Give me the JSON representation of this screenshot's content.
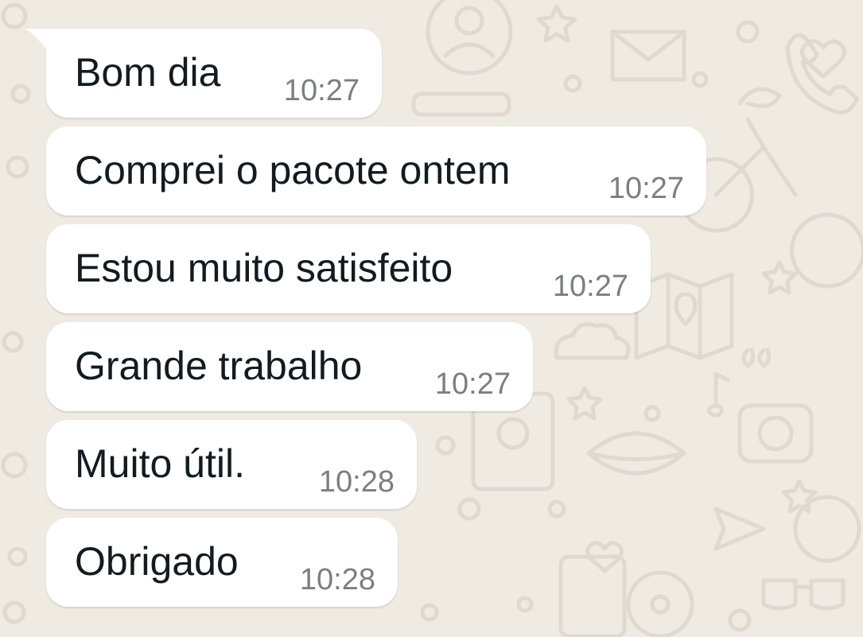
{
  "chat": {
    "background_color": "#efeae2",
    "bubble_color": "#ffffff",
    "text_color": "#111b21",
    "time_color": "#7a7f82",
    "messages": [
      {
        "text": "Bom dia",
        "time": "10:27"
      },
      {
        "text": "Comprei o pacote ontem",
        "time": "10:27"
      },
      {
        "text": "Estou muito satisfeito",
        "time": "10:27"
      },
      {
        "text": "Grande trabalho",
        "time": "10:27"
      },
      {
        "text": "Muito útil.",
        "time": "10:28"
      },
      {
        "text": "Obrigado",
        "time": "10:28"
      }
    ]
  }
}
